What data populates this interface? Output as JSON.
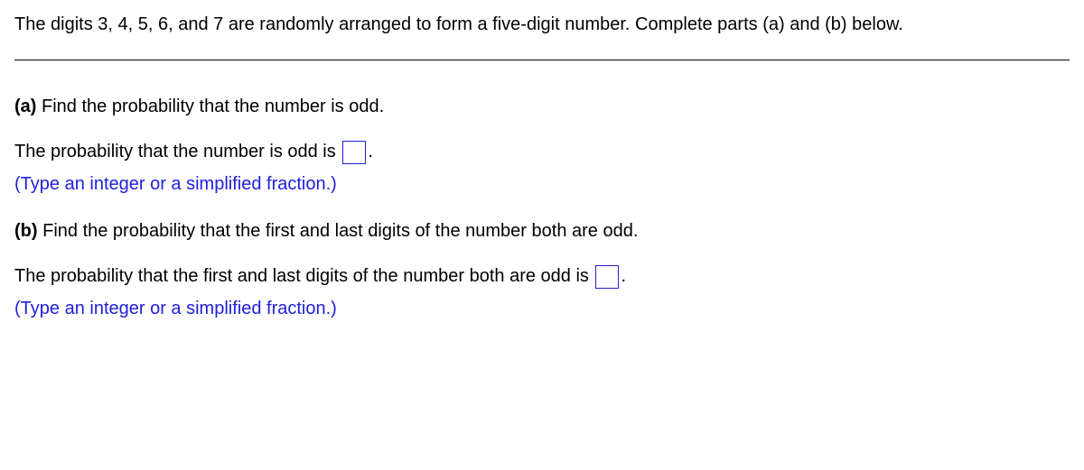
{
  "intro": "The digits 3, 4, 5, 6, and 7 are randomly arranged to form a five-digit number. Complete parts (a) and (b) below.",
  "partA": {
    "label": "(a)",
    "question": " Find the probability that the number is odd.",
    "answerPrefix": "The probability that the number is odd is ",
    "answerSuffix": ".",
    "hint": "(Type an integer or a simplified fraction.)"
  },
  "partB": {
    "label": "(b)",
    "question": " Find the probability that the first and last digits of the number both are odd.",
    "answerPrefix": "The probability that the first and last digits of the number both are odd is ",
    "answerSuffix": ".",
    "hint": "(Type an integer or a simplified fraction.)"
  }
}
